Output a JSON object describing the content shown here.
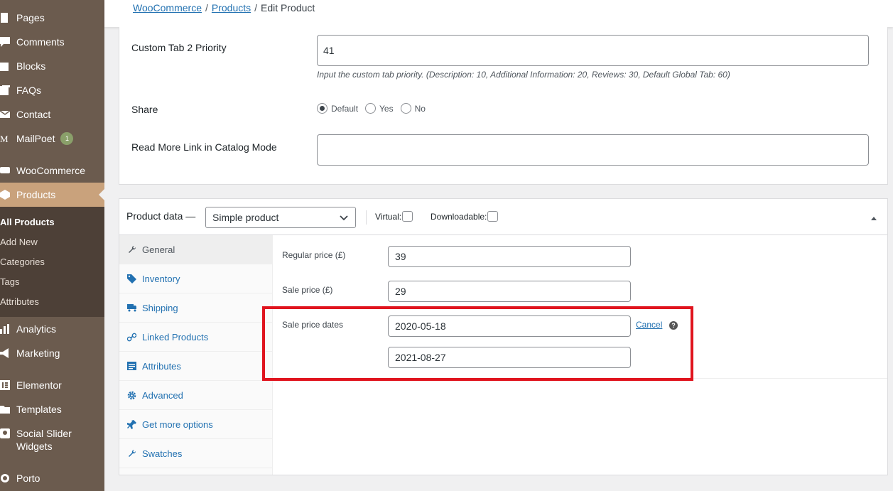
{
  "sidebar": {
    "items": [
      {
        "label": "Pages",
        "icon": "pages-icon"
      },
      {
        "label": "Comments",
        "icon": "comments-icon"
      },
      {
        "label": "Blocks",
        "icon": "blocks-icon"
      },
      {
        "label": "FAQs",
        "icon": "faqs-icon"
      },
      {
        "label": "Contact",
        "icon": "contact-icon"
      },
      {
        "label": "MailPoet",
        "icon": "mailpoet-icon",
        "badge": "1"
      },
      {
        "label": "WooCommerce",
        "icon": "woocommerce-icon"
      },
      {
        "label": "Products",
        "icon": "products-icon"
      },
      {
        "label": "Analytics",
        "icon": "analytics-icon"
      },
      {
        "label": "Marketing",
        "icon": "marketing-icon"
      },
      {
        "label": "Elementor",
        "icon": "elementor-icon"
      },
      {
        "label": "Templates",
        "icon": "templates-icon"
      },
      {
        "label": "Social Slider",
        "label2": "Widgets",
        "icon": "social-slider-icon"
      },
      {
        "label": "Porto",
        "icon": "porto-icon"
      }
    ],
    "submenu": [
      "All Products",
      "Add New",
      "Categories",
      "Tags",
      "Attributes"
    ]
  },
  "breadcrumb": {
    "woocommerce": "WooCommerce",
    "products": "Products",
    "current": "Edit Product",
    "separator": "/"
  },
  "custom_fields": {
    "tab2_priority_label": "Custom Tab 2 Priority",
    "tab2_priority_value": "41",
    "tab2_priority_desc": "Input the custom tab priority. (Description: 10, Additional Information: 20, Reviews: 30, Default Global Tab: 60)",
    "share_label": "Share",
    "share_options": [
      "Default",
      "Yes",
      "No"
    ],
    "share_selected": "Default",
    "readmore_label": "Read More Link in Catalog Mode",
    "readmore_value": ""
  },
  "product_data": {
    "title": "Product data —",
    "type_selected": "Simple product",
    "virtual_label": "Virtual:",
    "downloadable_label": "Downloadable:",
    "tabs": [
      {
        "label": "General",
        "icon": "wrench-icon"
      },
      {
        "label": "Inventory",
        "icon": "tag-icon"
      },
      {
        "label": "Shipping",
        "icon": "truck-icon"
      },
      {
        "label": "Linked Products",
        "icon": "link-icon"
      },
      {
        "label": "Attributes",
        "icon": "list-icon"
      },
      {
        "label": "Advanced",
        "icon": "gear-icon"
      },
      {
        "label": "Get more options",
        "icon": "plugin-icon"
      },
      {
        "label": "Swatches",
        "icon": "wrench-icon"
      }
    ],
    "regular_price_label": "Regular price (£)",
    "regular_price_value": "39",
    "sale_price_label": "Sale price (£)",
    "sale_price_value": "29",
    "sale_dates_label": "Sale price dates",
    "sale_date_from": "2020-05-18",
    "sale_date_to": "2021-08-27",
    "cancel_label": "Cancel",
    "help_glyph": "?"
  },
  "colors": {
    "sidebar_bg": "#6b5b4e",
    "sidebar_active": "#c9a27c",
    "link": "#2271b1",
    "highlight": "#e0141e"
  }
}
